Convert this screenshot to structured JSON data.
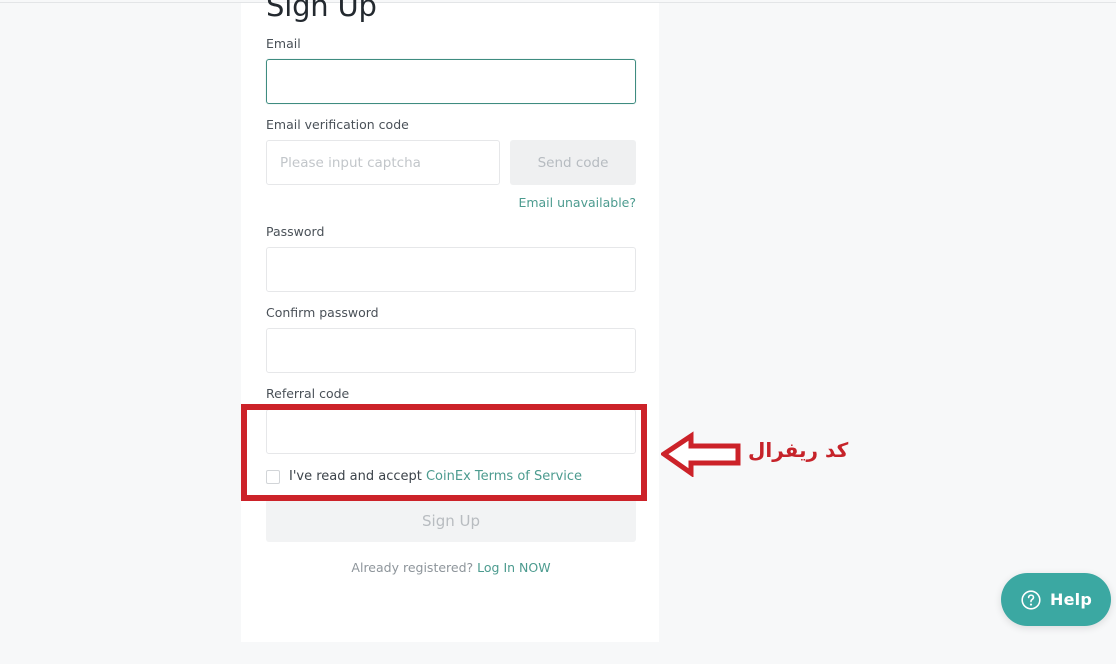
{
  "page": {
    "background_color": "#f7f8f9",
    "card_background": "#ffffff"
  },
  "colors": {
    "accent_teal": "#4c9b8f",
    "help_teal": "#3ba8a2",
    "annotation_red": "#cc2229",
    "focus_border": "#3f8c80",
    "input_border": "#e6e7e9",
    "disabled_button_bg": "#f2f3f4",
    "disabled_button_text": "#b8bcc0"
  },
  "signup": {
    "title": "Sign Up",
    "email": {
      "label": "Email",
      "value": "",
      "placeholder": ""
    },
    "verification": {
      "label": "Email verification code",
      "value": "",
      "placeholder": "Please input captcha",
      "send_code_label": "Send code",
      "email_unavailable_label": "Email unavailable?"
    },
    "password": {
      "label": "Password",
      "value": "",
      "placeholder": ""
    },
    "confirm_password": {
      "label": "Confirm password",
      "value": "",
      "placeholder": ""
    },
    "referral": {
      "label": "Referral code",
      "value": "",
      "placeholder": ""
    },
    "terms": {
      "checked": false,
      "prefix_text": "I've read and accept ",
      "link_text": "CoinEx Terms of Service"
    },
    "submit_label": "Sign Up",
    "footer": {
      "prompt": "Already registered? ",
      "link_text": "Log In NOW"
    }
  },
  "annotation": {
    "text": "کد ریفرال",
    "arrow_icon": "left-arrow-icon",
    "highlight_target": "referral-code-field"
  },
  "help_widget": {
    "label": "Help",
    "icon": "question-circle-icon"
  }
}
